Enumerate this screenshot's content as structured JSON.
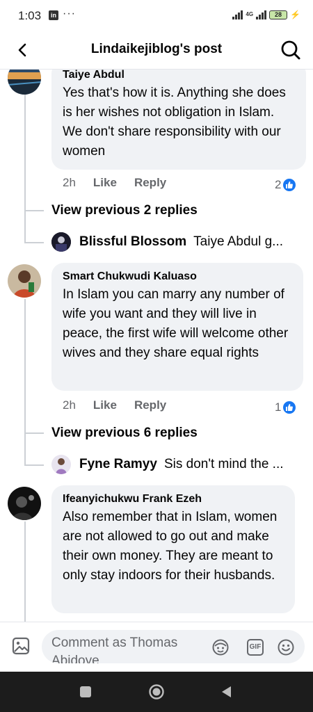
{
  "status_bar": {
    "time": "1:03",
    "app_icon": "in",
    "more": "···",
    "network": "4G",
    "battery": "28"
  },
  "header": {
    "title": "Lindaikejiblog's post",
    "back_icon": "chevron-left-icon",
    "search_icon": "search-icon"
  },
  "comments": [
    {
      "author": "Taiye Abdul",
      "text": "Yes that's how it is. Anything she does is her wishes not obligation in Islam. We don't share responsibility with our women",
      "time": "2h",
      "like_label": "Like",
      "reply_label": "Reply",
      "reaction_count": "2",
      "view_previous": "View previous 2 replies",
      "reply_preview": {
        "name": "Blissful Blossom",
        "text": "Taiye Abdul g..."
      }
    },
    {
      "author": "Smart Chukwudi Kaluaso",
      "text": "In Islam you can marry any number of wife you want and they will live in peace, the first wife will welcome other wives and they share equal rights",
      "time": "2h",
      "like_label": "Like",
      "reply_label": "Reply",
      "reaction_count": "1",
      "view_previous": "View previous 6 replies",
      "reply_preview": {
        "name": "Fyne Ramyy",
        "text": "Sis don't mind the ..."
      }
    },
    {
      "author": "Ifeanyichukwu Frank Ezeh",
      "text": "Also remember that in Islam, women are not allowed to go out and make their own money. They are meant to only stay indoors for their husbands."
    }
  ],
  "composer": {
    "placeholder": "Comment as Thomas Abidoye",
    "gif_label": "GIF"
  },
  "colors": {
    "accent": "#1877f2",
    "bubble": "#f0f2f5",
    "secondary_text": "#65676b",
    "nav_bar": "#1c1c1c"
  }
}
